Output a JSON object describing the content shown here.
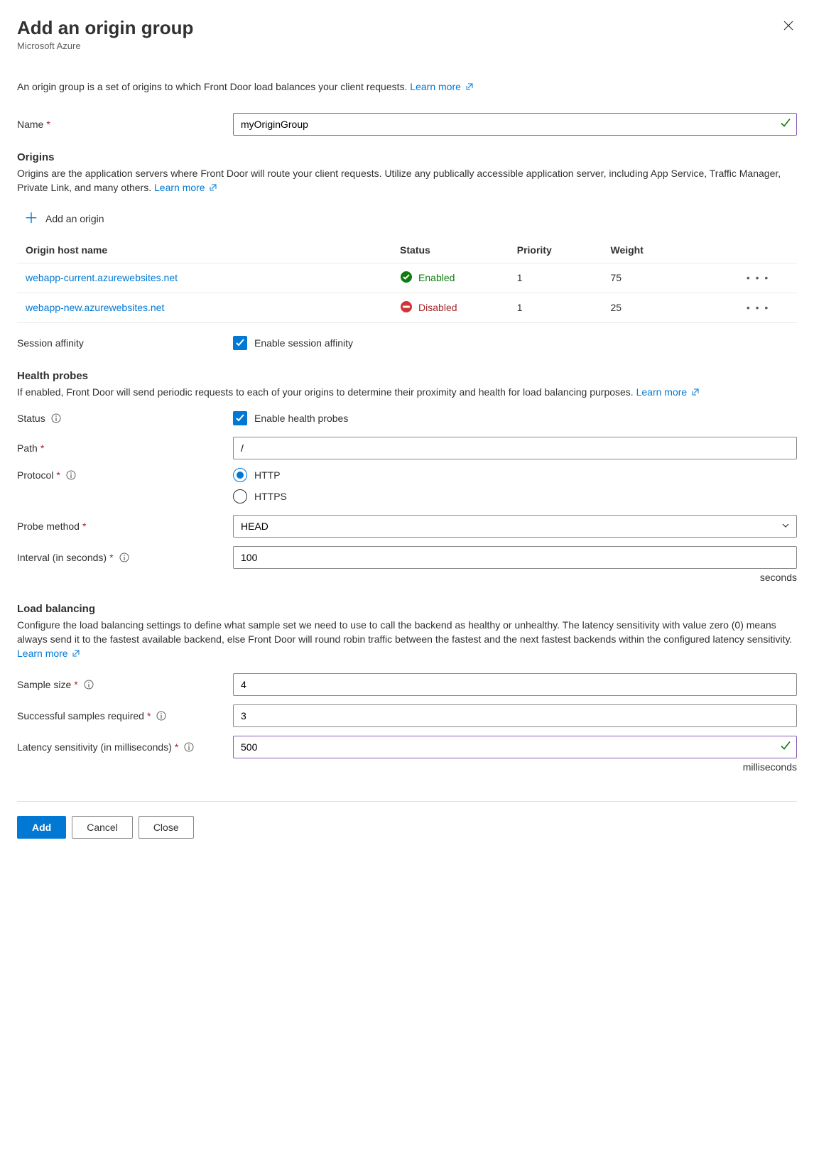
{
  "header": {
    "title": "Add an origin group",
    "subtitle": "Microsoft Azure"
  },
  "intro": {
    "text": "An origin group is a set of origins to which Front Door load balances your client requests. ",
    "learn_more": "Learn more"
  },
  "name_field": {
    "label": "Name",
    "value": "myOriginGroup"
  },
  "origins": {
    "heading": "Origins",
    "description": "Origins are the application servers where Front Door will route your client requests. Utilize any publically accessible application server, including App Service, Traffic Manager, Private Link, and many others. ",
    "learn_more": "Learn more",
    "add_label": "Add an origin",
    "columns": {
      "host": "Origin host name",
      "status": "Status",
      "priority": "Priority",
      "weight": "Weight"
    },
    "rows": [
      {
        "host": "webapp-current.azurewebsites.net",
        "status": "Enabled",
        "status_kind": "enabled",
        "priority": "1",
        "weight": "75"
      },
      {
        "host": "webapp-new.azurewebsites.net",
        "status": "Disabled",
        "status_kind": "disabled",
        "priority": "1",
        "weight": "25"
      }
    ]
  },
  "session_affinity": {
    "label": "Session affinity",
    "checkbox_label": "Enable session affinity",
    "checked": true
  },
  "health_probes": {
    "heading": "Health probes",
    "description": "If enabled, Front Door will send periodic requests to each of your origins to determine their proximity and health for load balancing purposes. ",
    "learn_more": "Learn more",
    "status_label": "Status",
    "status_checkbox_label": "Enable health probes",
    "path_label": "Path",
    "path_value": "/",
    "protocol_label": "Protocol",
    "protocol_options": {
      "http": "HTTP",
      "https": "HTTPS"
    },
    "protocol_selected": "http",
    "probe_method_label": "Probe method",
    "probe_method_value": "HEAD",
    "interval_label": "Interval (in seconds)",
    "interval_value": "100",
    "interval_unit": "seconds"
  },
  "load_balancing": {
    "heading": "Load balancing",
    "description": "Configure the load balancing settings to define what sample set we need to use to call the backend as healthy or unhealthy. The latency sensitivity with value zero (0) means always send it to the fastest available backend, else Front Door will round robin traffic between the fastest and the next fastest backends within the configured latency sensitivity. ",
    "learn_more": "Learn more",
    "sample_size_label": "Sample size",
    "sample_size_value": "4",
    "successful_label": "Successful samples required",
    "successful_value": "3",
    "latency_label": "Latency sensitivity (in milliseconds)",
    "latency_value": "500",
    "latency_unit": "milliseconds"
  },
  "footer": {
    "add": "Add",
    "cancel": "Cancel",
    "close": "Close"
  }
}
